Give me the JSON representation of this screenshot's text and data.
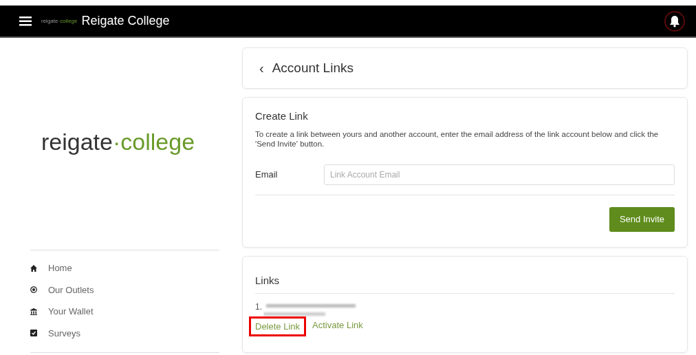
{
  "navbar": {
    "logo": {
      "primary": "reigate",
      "secondary": "·college"
    },
    "title": "Reigate College"
  },
  "sidebar": {
    "logo": {
      "primary": "reigate",
      "secondary": "·college"
    },
    "items": [
      {
        "label": "Home",
        "kind": "home"
      },
      {
        "label": "Our Outlets",
        "kind": "outlets"
      },
      {
        "label": "Your Wallet",
        "kind": "wallet"
      },
      {
        "label": "Surveys",
        "kind": "surveys"
      }
    ]
  },
  "header": {
    "back": "‹",
    "title": "Account Links"
  },
  "create_link": {
    "title": "Create Link",
    "description": "To create a link between yours and another account, enter the email address of the link account below and click the 'Send Invite' button.",
    "email_label": "Email",
    "email_placeholder": "Link Account Email",
    "button": "Send Invite"
  },
  "links": {
    "title": "Links",
    "items": [
      {
        "number": "1.",
        "actions": [
          {
            "label": "Delete Link",
            "highlighted": true
          },
          {
            "label": "Activate Link",
            "highlighted": false
          }
        ]
      }
    ]
  }
}
